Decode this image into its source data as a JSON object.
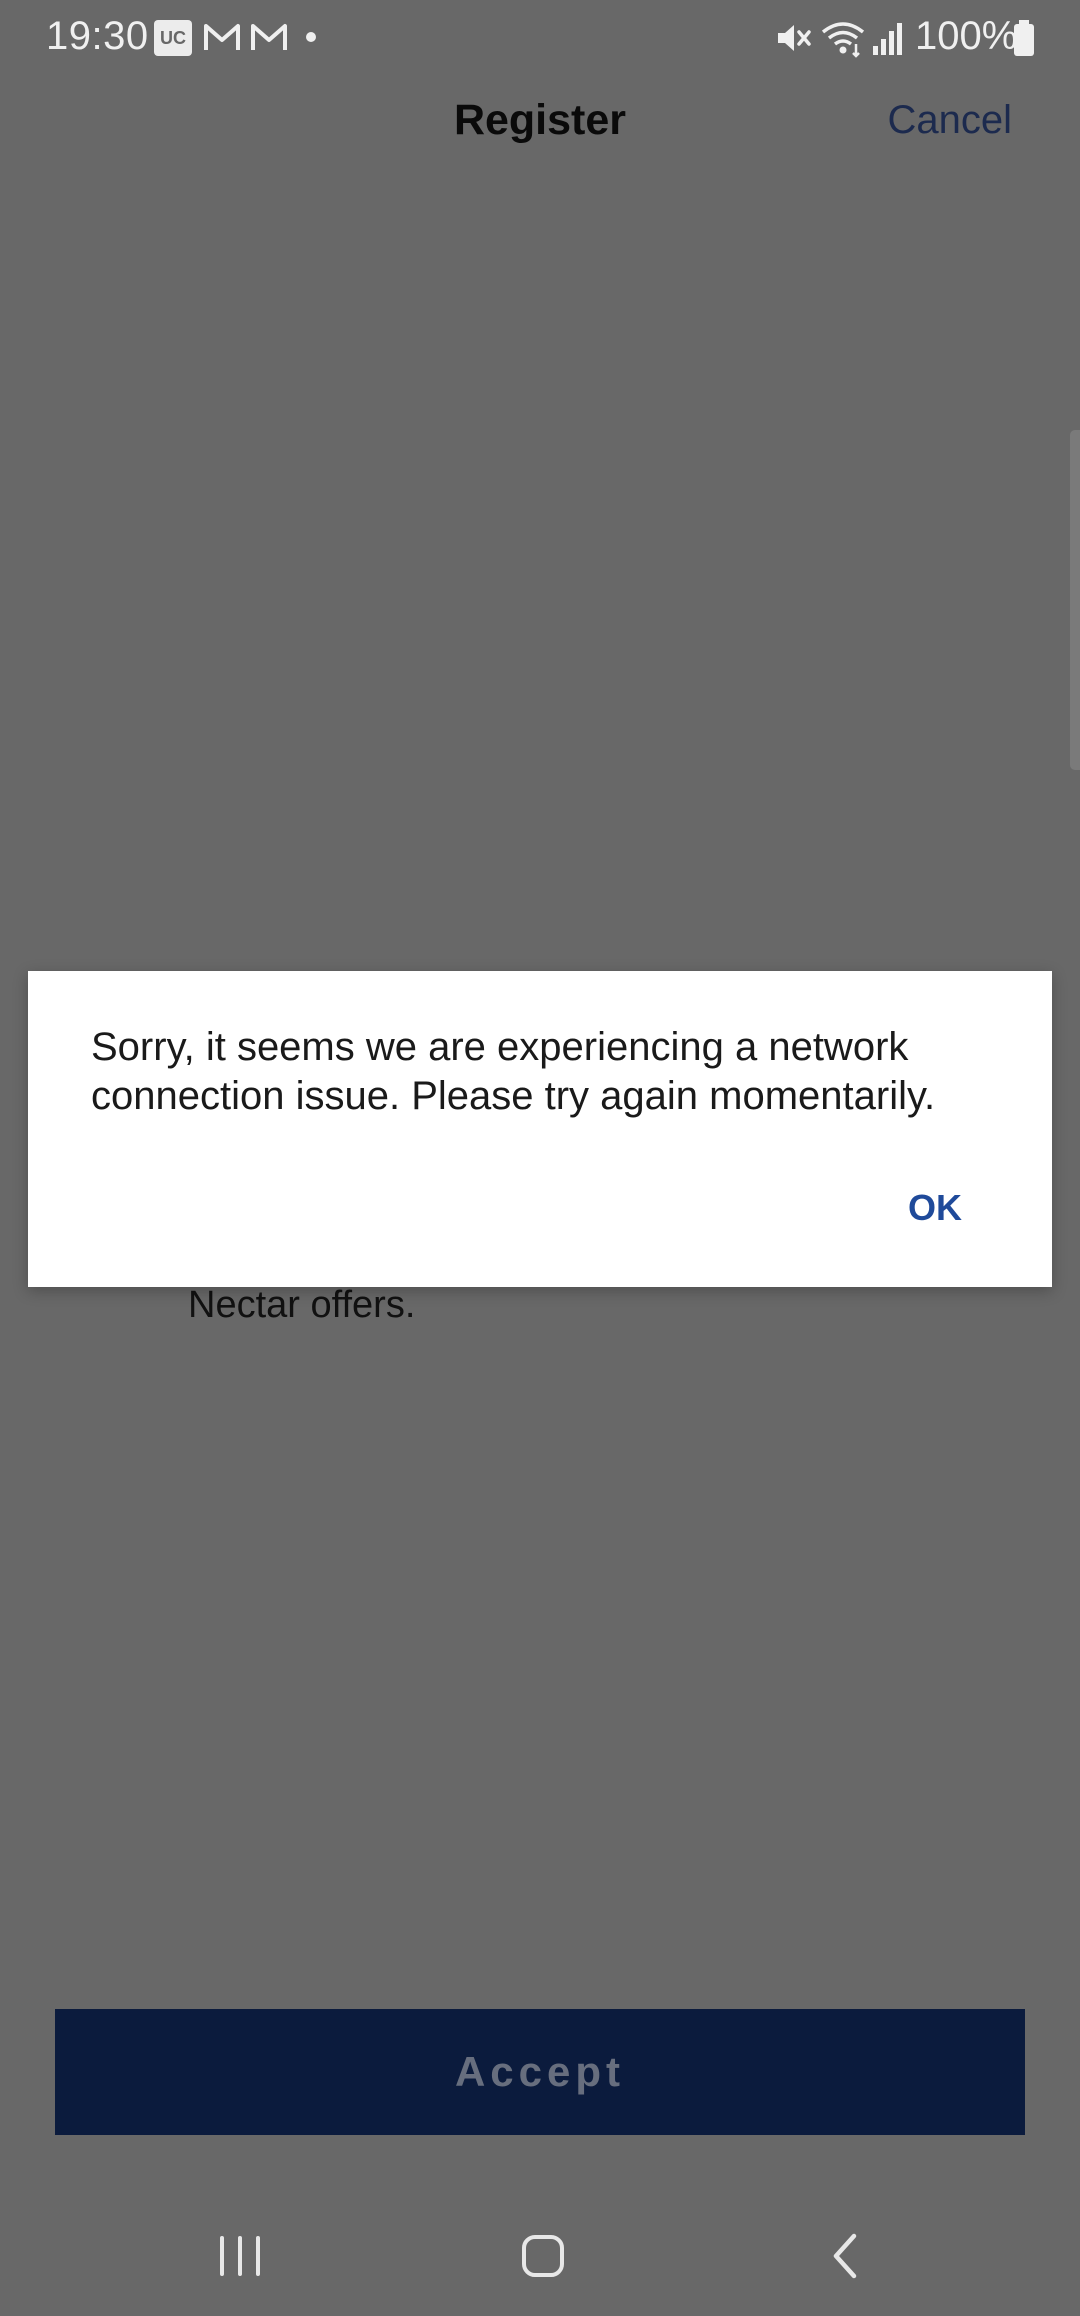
{
  "status_bar": {
    "time": "19:30",
    "uc_badge": "UC",
    "battery": "100%",
    "icons": [
      "uc-browser-icon",
      "gmail-icon",
      "gmail-icon",
      "dot-icon",
      "mute-icon",
      "wifi-icon",
      "signal-icon",
      "battery-icon"
    ]
  },
  "header": {
    "title": "Register",
    "cancel_label": "Cancel"
  },
  "background": {
    "visible_text": "Nectar offers."
  },
  "dialog": {
    "message": "Sorry, it seems we are experiencing a network connection issue. Please try again momentarily.",
    "ok_label": "OK"
  },
  "footer": {
    "accept_label": "Accept"
  },
  "nav_bar": {
    "icons": [
      "recent-apps-icon",
      "home-icon",
      "back-icon"
    ]
  },
  "colors": {
    "overlay_bg": "#686868",
    "accept_bg": "#0b1b3d",
    "link_blue": "#1f4a9a",
    "cancel_text": "#1c2a4e"
  }
}
